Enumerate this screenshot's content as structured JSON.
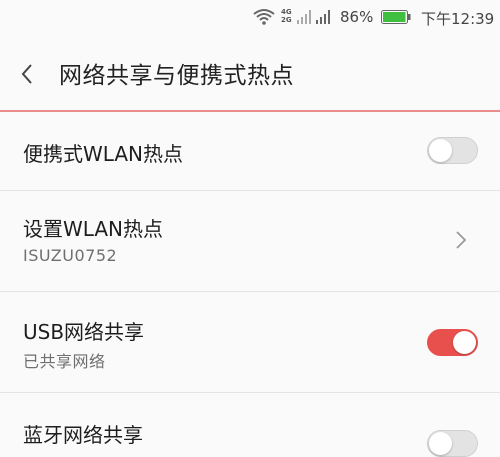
{
  "status_bar": {
    "network_top": "4G",
    "network_bottom": "2G",
    "battery_percent": "86%",
    "time": "下午12:39",
    "battery_color": "#3fbf3f"
  },
  "header": {
    "title": "网络共享与便携式热点",
    "accent_line_color": "#e88d8b"
  },
  "rows": [
    {
      "title": "便携式WLAN热点",
      "control": "toggle",
      "on": false
    },
    {
      "title": "设置WLAN热点",
      "subtitle": "ISUZU0752",
      "control": "chevron"
    },
    {
      "title": "USB网络共享",
      "subtitle": "已共享网络",
      "control": "toggle",
      "on": true
    },
    {
      "title": "蓝牙网络共享",
      "control": "toggle",
      "on": false
    }
  ],
  "colors": {
    "toggle_on": "#e8504d",
    "toggle_off": "#e3e3e3"
  }
}
